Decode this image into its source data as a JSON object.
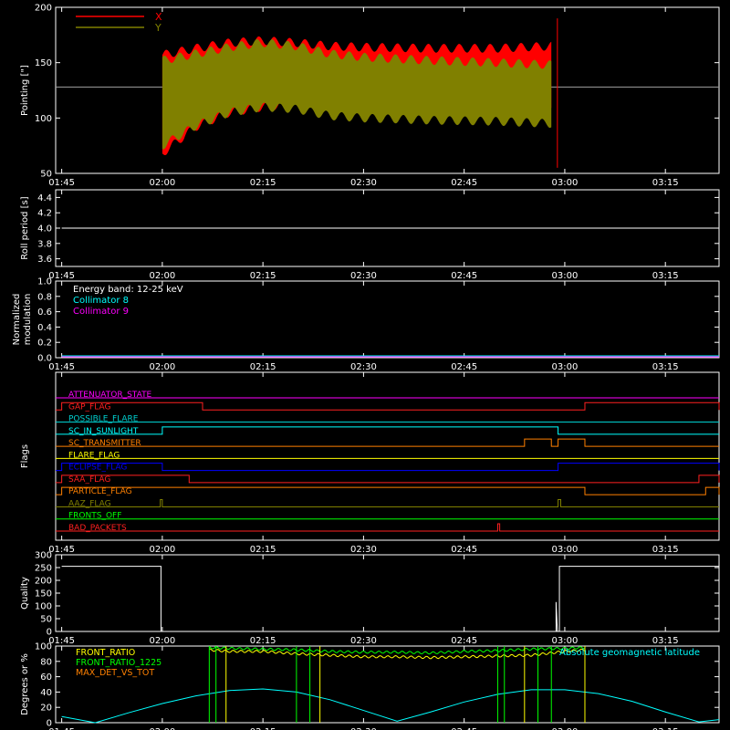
{
  "chart_data": [
    {
      "type": "area",
      "ylabel": "Pointing [\"]",
      "ylim": [
        50,
        200
      ],
      "yticks": [
        "50",
        "100",
        "150",
        "200"
      ],
      "xticks": [
        "01:45",
        "02:00",
        "02:15",
        "02:30",
        "02:45",
        "03:00",
        "03:15"
      ],
      "baseline": 128,
      "legend": [
        {
          "name": "X",
          "color": "#ff0000"
        },
        {
          "name": "Y",
          "color": "#808000"
        }
      ],
      "series": [
        {
          "name": "X",
          "color": "#ff0000",
          "time": [
            "02:00",
            "02:05",
            "02:10",
            "02:15",
            "02:20",
            "02:25",
            "02:30",
            "02:40",
            "02:50",
            "02:58"
          ],
          "upper": [
            157,
            163,
            168,
            170,
            168,
            165,
            164,
            163,
            163,
            165
          ],
          "lower": [
            68,
            92,
            105,
            110,
            113,
            115,
            115,
            115,
            115,
            113
          ]
        },
        {
          "name": "Y",
          "color": "#808000",
          "time": [
            "02:00",
            "02:05",
            "02:10",
            "02:15",
            "02:20",
            "02:25",
            "02:30",
            "02:40",
            "02:50",
            "02:58"
          ],
          "upper": [
            152,
            158,
            164,
            168,
            165,
            158,
            155,
            152,
            150,
            148
          ],
          "lower": [
            75,
            93,
            105,
            110,
            108,
            102,
            100,
            98,
            97,
            95
          ]
        }
      ]
    },
    {
      "type": "line",
      "ylabel": "Roll period [s]",
      "ylim": [
        3.5,
        4.5
      ],
      "yticks": [
        "3.6",
        "3.8",
        "4.0",
        "4.2",
        "4.4"
      ],
      "xticks": [
        "01:45",
        "02:00",
        "02:15",
        "02:30",
        "02:45",
        "03:00",
        "03:15"
      ],
      "series": [
        {
          "color": "#ffffff",
          "x": [
            "01:45",
            "03:23"
          ],
          "y": [
            4.0,
            4.0
          ]
        }
      ]
    },
    {
      "type": "line",
      "ylabel": "Normalized modulation",
      "ylim": [
        0,
        1.0
      ],
      "yticks": [
        "0.0",
        "0.2",
        "0.4",
        "0.6",
        "0.8",
        "1.0"
      ],
      "xticks": [
        "01:45",
        "02:00",
        "02:15",
        "02:30",
        "02:45",
        "03:00",
        "03:15"
      ],
      "annotations": [
        {
          "text": "Energy band: 12-25 keV",
          "color": "#ffffff"
        },
        {
          "text": "Collimator 8",
          "color": "#00ffff"
        },
        {
          "text": "Collimator 9",
          "color": "#ff00ff"
        }
      ],
      "series": [
        {
          "name": "Collimator 8",
          "color": "#00ffff",
          "x": [
            "01:45",
            "03:23"
          ],
          "y": [
            0,
            0
          ]
        },
        {
          "name": "Collimator 9",
          "color": "#ff00ff",
          "x": [
            "01:45",
            "03:23"
          ],
          "y": [
            0,
            0
          ]
        }
      ]
    },
    {
      "type": "line",
      "ylabel": "Flags",
      "xticks": [
        "01:45",
        "02:00",
        "02:15",
        "02:30",
        "02:45",
        "03:00",
        "03:15"
      ],
      "flags": [
        {
          "label": "ATTENUATOR_STATE",
          "color": "#ff00ff",
          "on": []
        },
        {
          "label": "GAP_FLAG",
          "color": "#ff2020",
          "on": [
            [
              "01:45",
              "02:06"
            ],
            [
              "03:03",
              "03:23"
            ]
          ]
        },
        {
          "label": "POSSIBLE_FLARE",
          "color": "#00d0d0",
          "on": []
        },
        {
          "label": "SC_IN_SUNLIGHT",
          "color": "#00ffff",
          "on": [
            [
              "02:00",
              "02:59"
            ]
          ]
        },
        {
          "label": "SC_TRANSMITTER",
          "color": "#ff8000",
          "on": [
            [
              "02:54",
              "02:58"
            ],
            [
              "02:59",
              "03:03"
            ]
          ]
        },
        {
          "label": "FLARE_FLAG",
          "color": "#ffff00",
          "on": []
        },
        {
          "label": "ECLIPSE_FLAG",
          "color": "#0000ff",
          "on": [
            [
              "01:45",
              "02:00"
            ],
            [
              "02:59",
              "03:23"
            ]
          ]
        },
        {
          "label": "SAA_FLAG",
          "color": "#ff2020",
          "on": [
            [
              "01:45",
              "02:04"
            ],
            [
              "03:20",
              "03:23"
            ]
          ]
        },
        {
          "label": "PARTICLE_FLAG",
          "color": "#ff8000",
          "on": [
            [
              "01:45",
              "03:03"
            ],
            [
              "03:21",
              "03:23"
            ]
          ]
        },
        {
          "label": "AAZ_FLAG",
          "color": "#808000",
          "on": [
            [
              "01:59.7",
              "02:00"
            ],
            [
              "02:59",
              "02:59.4"
            ]
          ]
        },
        {
          "label": "FRONTS_OFF",
          "color": "#00ff00",
          "on": []
        },
        {
          "label": "BAD_PACKETS",
          "color": "#ff2020",
          "on": [
            [
              "02:50",
              "02:50.3"
            ]
          ]
        }
      ]
    },
    {
      "type": "line",
      "ylabel": "Quality",
      "ylim": [
        0,
        300
      ],
      "yticks": [
        "0",
        "50",
        "100",
        "150",
        "200",
        "250",
        "300"
      ],
      "xticks": [
        "01:45",
        "02:00",
        "02:15",
        "02:30",
        "02:45",
        "03:00",
        "03:15"
      ],
      "series": [
        {
          "color": "#ffffff",
          "x": [
            "01:45",
            "01:59.8",
            "01:59.8",
            "02:58.7",
            "02:58.7",
            "02:58.9",
            "02:59.2",
            "02:59.2",
            "03:23"
          ],
          "y": [
            255,
            255,
            0,
            0,
            115,
            0,
            0,
            255,
            255
          ]
        }
      ]
    },
    {
      "type": "line",
      "ylabel": "Degrees or %",
      "ylim": [
        0,
        100
      ],
      "yticks": [
        "0",
        "20",
        "40",
        "60",
        "80",
        "100"
      ],
      "xticks": [
        "01:45",
        "02:00",
        "02:15",
        "02:30",
        "02:45",
        "03:00",
        "03:15"
      ],
      "legend": [
        {
          "name": "FRONT_RATIO",
          "color": "#ffff00"
        },
        {
          "name": "FRONT_RATIO_1225",
          "color": "#00ff00"
        },
        {
          "name": "MAX_DET_VS_TOT",
          "color": "#ff8000"
        },
        {
          "name": "Absolute geomagnetic latitude",
          "color": "#00ffff"
        }
      ],
      "series": [
        {
          "name": "Absolute geomagnetic latitude",
          "color": "#00ffff",
          "x": [
            "01:45",
            "01:50",
            "01:55",
            "02:00",
            "02:05",
            "02:10",
            "02:15",
            "02:20",
            "02:25",
            "02:30",
            "02:35",
            "02:40",
            "02:45",
            "02:50",
            "02:55",
            "03:00",
            "03:05",
            "03:10",
            "03:15",
            "03:20",
            "03:23"
          ],
          "y": [
            8,
            0,
            13,
            25,
            35,
            42,
            44,
            40,
            30,
            16,
            2,
            14,
            27,
            37,
            43,
            43,
            38,
            28,
            14,
            1,
            4
          ]
        },
        {
          "name": "FRONT_RATIO",
          "color": "#ffff00",
          "x": [
            "02:07",
            "02:10",
            "02:15",
            "02:20",
            "02:25",
            "02:30",
            "02:35",
            "02:40",
            "02:45",
            "02:50",
            "02:55",
            "03:00",
            "03:03"
          ],
          "y": [
            95,
            93,
            93,
            90,
            88,
            86,
            86,
            85,
            86,
            87,
            88,
            93,
            95
          ]
        },
        {
          "name": "FRONT_RATIO_1225",
          "color": "#00ff00",
          "x": [
            "02:07",
            "02:10",
            "02:15",
            "02:20",
            "02:25",
            "02:30",
            "02:35",
            "02:40",
            "02:45",
            "02:50",
            "02:55",
            "03:00",
            "03:03"
          ],
          "y": [
            98,
            97,
            96,
            95,
            93,
            92,
            92,
            91,
            93,
            94,
            96,
            97,
            98
          ]
        }
      ]
    }
  ]
}
